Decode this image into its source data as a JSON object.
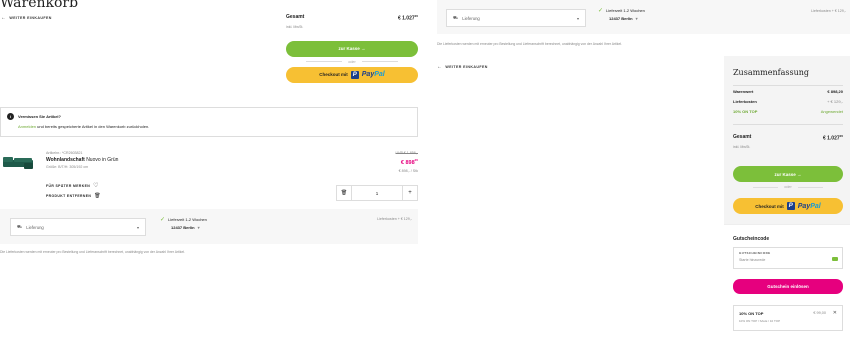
{
  "page": {
    "title": "Warenkorb",
    "back_label": "WEITER EINKAUFEN",
    "back_label_right": "WEITER EINKAUFEN"
  },
  "total_box": {
    "label": "Gesamt",
    "amount": "€ 1.027",
    "amount_sup": "20",
    "tax": "inkl. MwSt.",
    "checkout_label": "zur Kasse",
    "or_label": "oder",
    "paypal_label": "Checkout mit",
    "paypal_brand_1": "Pay",
    "paypal_brand_2": "Pal"
  },
  "notice": {
    "title": "Vermissen Sie Artikel?",
    "link": "Anmelden",
    "text": "und bereits gespeicherte Artikel in den Warenkorb zurückholen."
  },
  "product": {
    "article_no": "Artikelnr.: *CR2603821",
    "name": "Wohnlandschaft",
    "variant": "Nuovo in Grün",
    "size": "Größe:   B/T/H: 305/192 cm",
    "old_price": "UVP € 1.856,-",
    "price": "€ 898",
    "price_sup": "20",
    "per_unit": "€ 898,- / Stk",
    "save_label": "FÜR SPÄTER MERKEN",
    "remove_label": "PRODUKT ENTFERNEN",
    "quantity": "1",
    "minus": "−",
    "plus": "+"
  },
  "delivery_left": {
    "select_value": "Lieferung",
    "eta": "Lieferzeit 1-2 Wochen",
    "city": "12437 Berlin",
    "cost": "Lieferkosten   + € 129,-",
    "disclaimer": "Die Lieferkosten werden mit erneuter pro Bestellung und Lieferanschrift berechnet, unabhängig von der Anzahl Ihrer Artikel."
  },
  "delivery_right": {
    "select_value": "Lieferung",
    "eta": "Lieferzeit 1-2 Wochen",
    "city": "12437 Berlin",
    "cost": "Lieferkosten   + € 129,-",
    "disclaimer": "Die Lieferkosten werden mit erneuter pro Bestellung und Lieferanschrift berechnet, unabhängig von der Anzahl Ihrer Artikel."
  },
  "summary": {
    "title": "Zusammenfassung",
    "rows": [
      {
        "label": "Warenwert",
        "value": "€ 898,20"
      },
      {
        "label": "Lieferkosten",
        "value": "+ € 129,-"
      },
      {
        "label": "10% ON TOP",
        "value": "Angewendet"
      }
    ],
    "total_label": "Gesamt",
    "total_value": "€ 1.027",
    "total_sup": "20",
    "tax": "inkl. MwSt.",
    "checkout_label": "zur Kasse",
    "or_label": "oder",
    "paypal_label": "Checkout mit",
    "paypal_brand_1": "Pay",
    "paypal_brand_2": "Pal"
  },
  "voucher": {
    "title": "Gutscheincode",
    "field_label": "GUTSCHEINCODE",
    "placeholder": "Starte hinzurede",
    "redeem_label": "Gutschein einlösen",
    "applied_name": "10% ON TOP",
    "applied_sub": "10% ON TOP / SALE / 10 TOP",
    "applied_value": "€ 99,00"
  },
  "colors": {
    "green": "#7cbf3a",
    "pink": "#e6007e",
    "yellow": "#f7c033",
    "paypal_dark": "#1b3f8b",
    "paypal_light": "#179bd7"
  }
}
